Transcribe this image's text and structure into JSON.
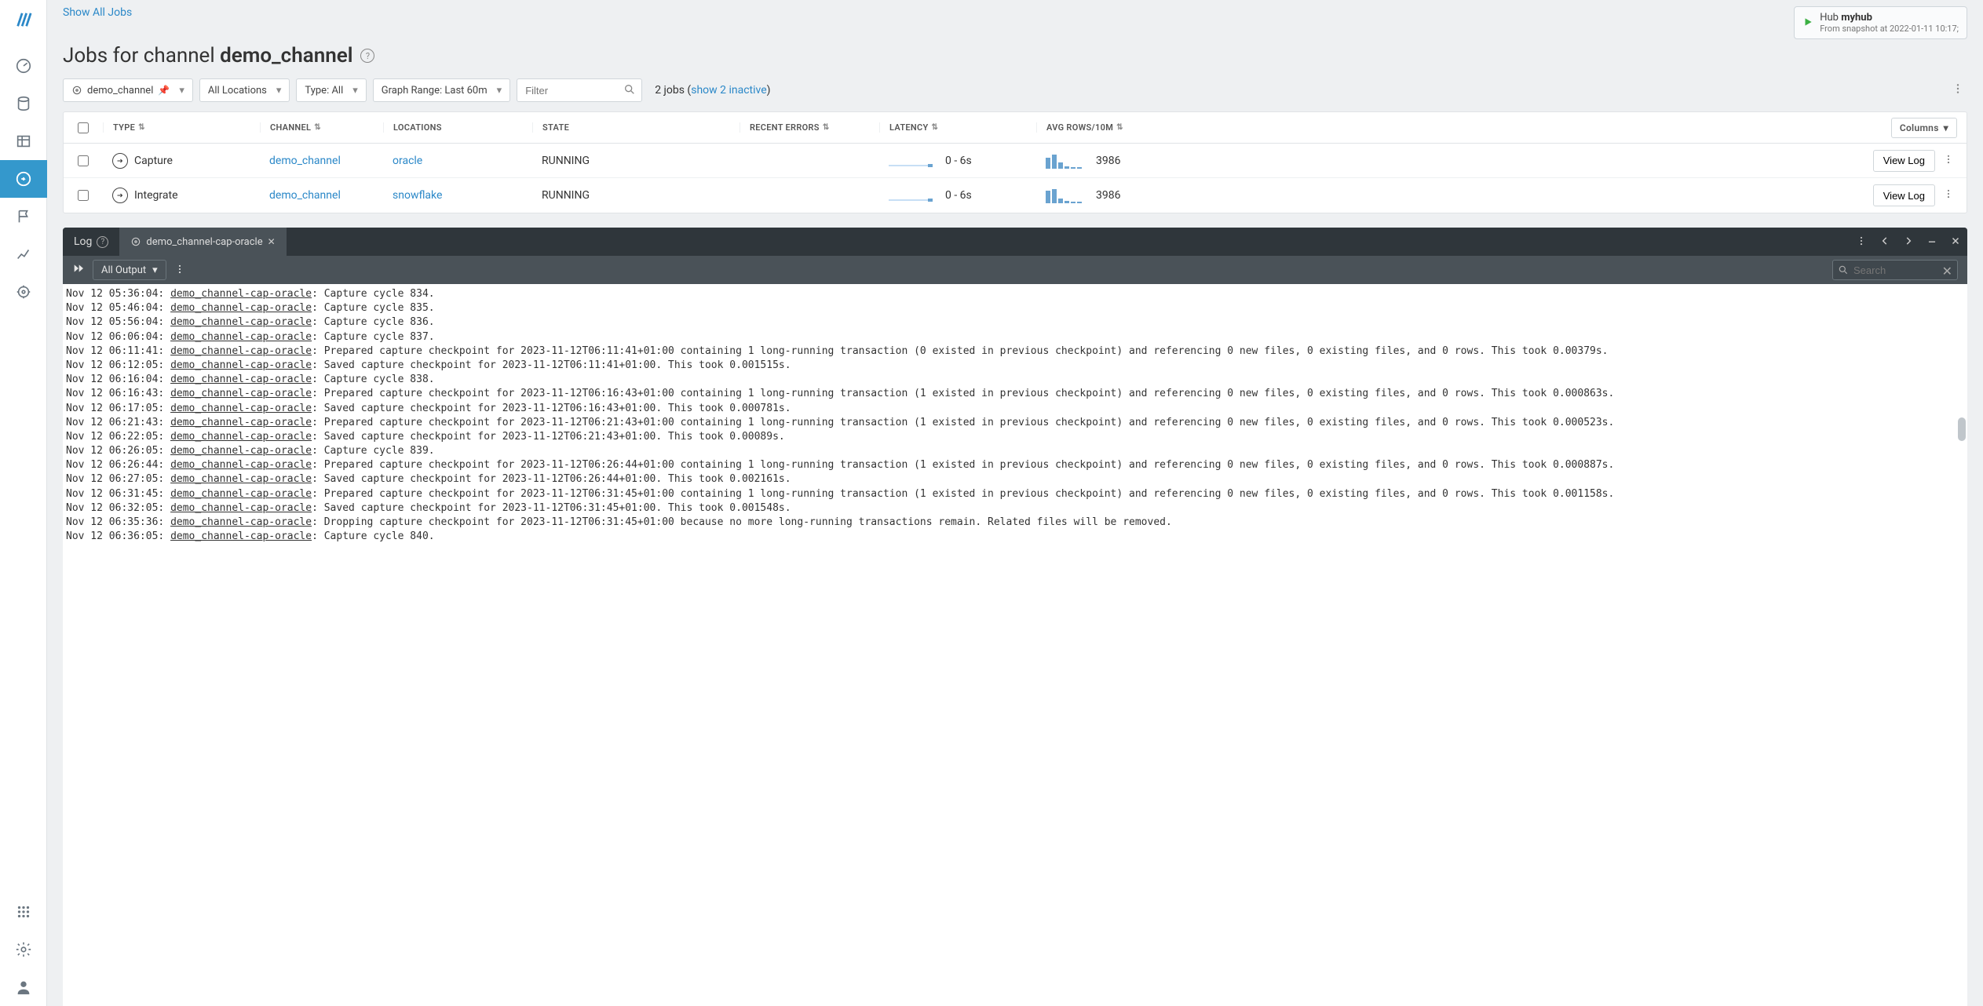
{
  "breadcrumb": {
    "show_all": "Show All Jobs"
  },
  "hub": {
    "prefix": "Hub",
    "name": "myhub",
    "snapshot": "From snapshot at 2022-01-11 10:17;"
  },
  "title": {
    "prefix": "Jobs for channel ",
    "bold": "demo_channel"
  },
  "filters": {
    "channel": "demo_channel",
    "locations": "All Locations",
    "type": "Type: All",
    "graph_range": "Graph Range: Last 60m",
    "filter_placeholder": "Filter",
    "jobcount_prefix": "2 jobs (",
    "jobcount_link": "show 2 inactive",
    "jobcount_suffix": ")"
  },
  "columns": {
    "type": "TYPE",
    "channel": "CHANNEL",
    "locations": "LOCATIONS",
    "state": "STATE",
    "errors": "RECENT ERRORS",
    "latency": "LATENCY",
    "avg": "AVG ROWS/10M",
    "columns_btn": "Columns"
  },
  "rows": [
    {
      "type": "Capture",
      "channel": "demo_channel",
      "location": "oracle",
      "state": "RUNNING",
      "latency": "0 - 6s",
      "avg": "3986",
      "viewlog": "View Log",
      "bars": [
        14,
        18,
        8,
        3,
        2,
        2
      ]
    },
    {
      "type": "Integrate",
      "channel": "demo_channel",
      "location": "snowflake",
      "state": "RUNNING",
      "latency": "0 - 6s",
      "avg": "3986",
      "viewlog": "View Log",
      "bars": [
        16,
        18,
        6,
        3,
        2,
        2
      ]
    }
  ],
  "log": {
    "title": "Log",
    "active_tab": "demo_channel-cap-oracle",
    "output_dd": "All Output",
    "search_placeholder": "Search",
    "lines": [
      {
        "ts": "Nov 12 05:36:04",
        "src": "demo_channel-cap-oracle",
        "msg": "Capture cycle 834."
      },
      {
        "ts": "Nov 12 05:46:04",
        "src": "demo_channel-cap-oracle",
        "msg": "Capture cycle 835."
      },
      {
        "ts": "Nov 12 05:56:04",
        "src": "demo_channel-cap-oracle",
        "msg": "Capture cycle 836."
      },
      {
        "ts": "Nov 12 06:06:04",
        "src": "demo_channel-cap-oracle",
        "msg": "Capture cycle 837."
      },
      {
        "ts": "Nov 12 06:11:41",
        "src": "demo_channel-cap-oracle",
        "msg": "Prepared capture checkpoint for 2023-11-12T06:11:41+01:00 containing 1 long-running transaction (0 existed in previous checkpoint) and referencing 0 new files, 0 existing files, and 0 rows. This took 0.00379s."
      },
      {
        "ts": "Nov 12 06:12:05",
        "src": "demo_channel-cap-oracle",
        "msg": "Saved capture checkpoint for 2023-11-12T06:11:41+01:00. This took 0.001515s."
      },
      {
        "ts": "Nov 12 06:16:04",
        "src": "demo_channel-cap-oracle",
        "msg": "Capture cycle 838."
      },
      {
        "ts": "Nov 12 06:16:43",
        "src": "demo_channel-cap-oracle",
        "msg": "Prepared capture checkpoint for 2023-11-12T06:16:43+01:00 containing 1 long-running transaction (1 existed in previous checkpoint) and referencing 0 new files, 0 existing files, and 0 rows. This took 0.000863s."
      },
      {
        "ts": "Nov 12 06:17:05",
        "src": "demo_channel-cap-oracle",
        "msg": "Saved capture checkpoint for 2023-11-12T06:16:43+01:00. This took 0.000781s."
      },
      {
        "ts": "Nov 12 06:21:43",
        "src": "demo_channel-cap-oracle",
        "msg": "Prepared capture checkpoint for 2023-11-12T06:21:43+01:00 containing 1 long-running transaction (1 existed in previous checkpoint) and referencing 0 new files, 0 existing files, and 0 rows. This took 0.000523s."
      },
      {
        "ts": "Nov 12 06:22:05",
        "src": "demo_channel-cap-oracle",
        "msg": "Saved capture checkpoint for 2023-11-12T06:21:43+01:00. This took 0.00089s."
      },
      {
        "ts": "Nov 12 06:26:05",
        "src": "demo_channel-cap-oracle",
        "msg": "Capture cycle 839."
      },
      {
        "ts": "Nov 12 06:26:44",
        "src": "demo_channel-cap-oracle",
        "msg": "Prepared capture checkpoint for 2023-11-12T06:26:44+01:00 containing 1 long-running transaction (1 existed in previous checkpoint) and referencing 0 new files, 0 existing files, and 0 rows. This took 0.000887s."
      },
      {
        "ts": "Nov 12 06:27:05",
        "src": "demo_channel-cap-oracle",
        "msg": "Saved capture checkpoint for 2023-11-12T06:26:44+01:00. This took 0.002161s."
      },
      {
        "ts": "Nov 12 06:31:45",
        "src": "demo_channel-cap-oracle",
        "msg": "Prepared capture checkpoint for 2023-11-12T06:31:45+01:00 containing 1 long-running transaction (1 existed in previous checkpoint) and referencing 0 new files, 0 existing files, and 0 rows. This took 0.001158s."
      },
      {
        "ts": "Nov 12 06:32:05",
        "src": "demo_channel-cap-oracle",
        "msg": "Saved capture checkpoint for 2023-11-12T06:31:45+01:00. This took 0.001548s."
      },
      {
        "ts": "Nov 12 06:35:36",
        "src": "demo_channel-cap-oracle",
        "msg": "Dropping capture checkpoint for 2023-11-12T06:31:45+01:00 because no more long-running transactions remain. Related files will be removed."
      },
      {
        "ts": "Nov 12 06:36:05",
        "src": "demo_channel-cap-oracle",
        "msg": "Capture cycle 840."
      }
    ]
  }
}
